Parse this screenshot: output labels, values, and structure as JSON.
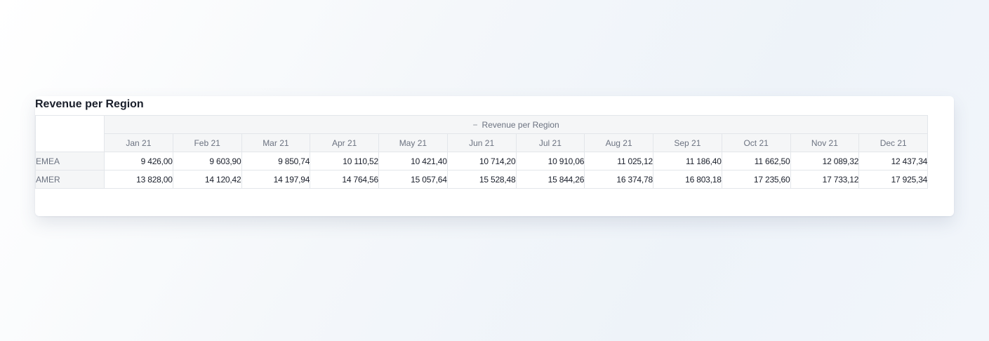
{
  "chart_data": {
    "type": "table",
    "title": "Revenue per Region",
    "column_group": "Revenue per Region",
    "columns": [
      "Jan 21",
      "Feb 21",
      "Mar 21",
      "Apr 21",
      "May 21",
      "Jun 21",
      "Jul 21",
      "Aug 21",
      "Sep 21",
      "Oct 21",
      "Nov 21",
      "Dec 21"
    ],
    "rows": [
      {
        "label": "EMEA",
        "cells": [
          "9 426,00",
          "9 603,90",
          "9 850,74",
          "10 110,52",
          "10 421,40",
          "10 714,20",
          "10 910,06",
          "11 025,12",
          "11 186,40",
          "11 662,50",
          "12 089,32",
          "12 437,34"
        ]
      },
      {
        "label": "AMER",
        "cells": [
          "13 828,00",
          "14 120,42",
          "14 197,94",
          "14 764,56",
          "15 057,64",
          "15 528,48",
          "15 844,26",
          "16 374,78",
          "16 803,18",
          "17 235,60",
          "17 733,12",
          "17 925,34"
        ]
      }
    ],
    "series": [
      {
        "name": "EMEA",
        "values": [
          9426.0,
          9603.9,
          9850.74,
          10110.52,
          10421.4,
          10714.2,
          10910.06,
          11025.12,
          11186.4,
          11662.5,
          12089.32,
          12437.34
        ]
      },
      {
        "name": "AMER",
        "values": [
          13828.0,
          14120.42,
          14197.94,
          14764.56,
          15057.64,
          15528.48,
          15844.26,
          16374.78,
          16803.18,
          17235.6,
          17733.12,
          17925.34
        ]
      }
    ]
  },
  "header": {
    "collapse_glyph": "−"
  },
  "colors": {
    "header_background": "#f5f6f7",
    "header_text": "#6b7280",
    "value_text": "#1a1f2b",
    "border": "#e3e6ea"
  }
}
